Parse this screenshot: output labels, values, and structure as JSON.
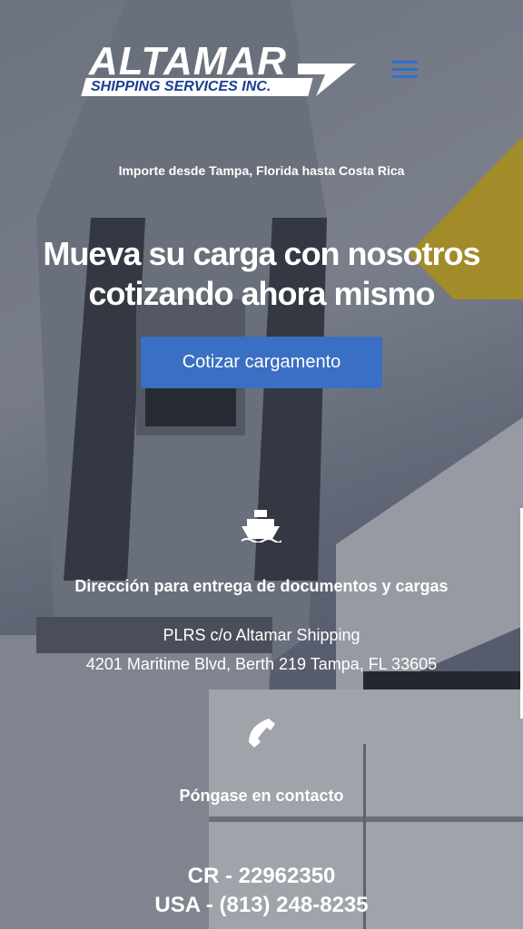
{
  "header": {
    "logo_main": "ALTAMAR",
    "logo_sub": "SHIPPING SERVICES INC.",
    "menu_icon": "hamburger-icon"
  },
  "hero": {
    "tagline": "Importe desde Tampa, Florida hasta Costa Rica",
    "headline_line1": "Mueva su carga con nosotros",
    "headline_line2": "cotizando ahora mismo",
    "cta_label": "Cotizar cargamento"
  },
  "address": {
    "icon": "ship-icon",
    "title": "Dirección para entrega de documentos y cargas",
    "line1": "PLRS c/o Altamar Shipping",
    "line2": "4201 Maritime Blvd, Berth 219 Tampa, FL 33605"
  },
  "contact": {
    "icon": "phone-icon",
    "title": "Póngase en contacto",
    "phone_cr": "CR - 22962350",
    "phone_usa": "USA - (813) 248-8235"
  },
  "colors": {
    "accent": "#3a6fc4",
    "menu": "#2e6fd0"
  }
}
